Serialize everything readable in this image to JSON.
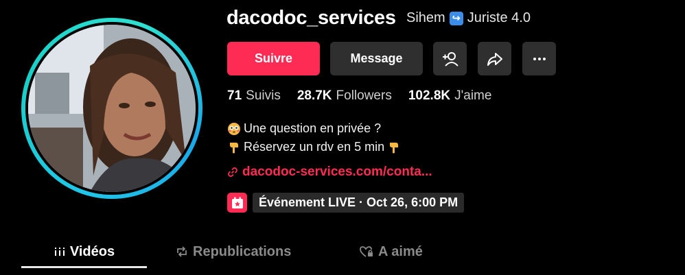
{
  "profile": {
    "username": "dacodoc_services",
    "nickname": "Sihem",
    "nickname_suffix": "Juriste 4.0"
  },
  "actions": {
    "follow_label": "Suivre",
    "message_label": "Message"
  },
  "stats": [
    {
      "value": "71",
      "label": "Suivis"
    },
    {
      "value": "28.7K",
      "label": "Followers"
    },
    {
      "value": "102.8K",
      "label": "J'aime"
    }
  ],
  "bio": {
    "line1": "Une question en privée ?",
    "line2": "Réservez un rdv en 5 min"
  },
  "link": {
    "text": "dacodoc-services.com/conta..."
  },
  "event": {
    "text": "Événement LIVE · Oct 26, 6:00 PM"
  },
  "tabs": [
    {
      "label": "Vidéos",
      "active": true
    },
    {
      "label": "Republications",
      "active": false
    },
    {
      "label": "A aimé",
      "active": false
    }
  ],
  "colors": {
    "accent": "#fe2c55",
    "background": "#000000",
    "button_secondary": "#2f2f2f",
    "ring": "#21c6e8"
  },
  "icons": {
    "nickname": "arrow-return-icon",
    "add_user": "add-user-icon",
    "share": "share-icon",
    "more": "more-dots-icon",
    "link": "link-icon",
    "event": "calendar-star-icon",
    "videos_tab": "grid-bars-icon",
    "reposts_tab": "repost-icon",
    "liked_tab": "heart-lock-icon"
  }
}
